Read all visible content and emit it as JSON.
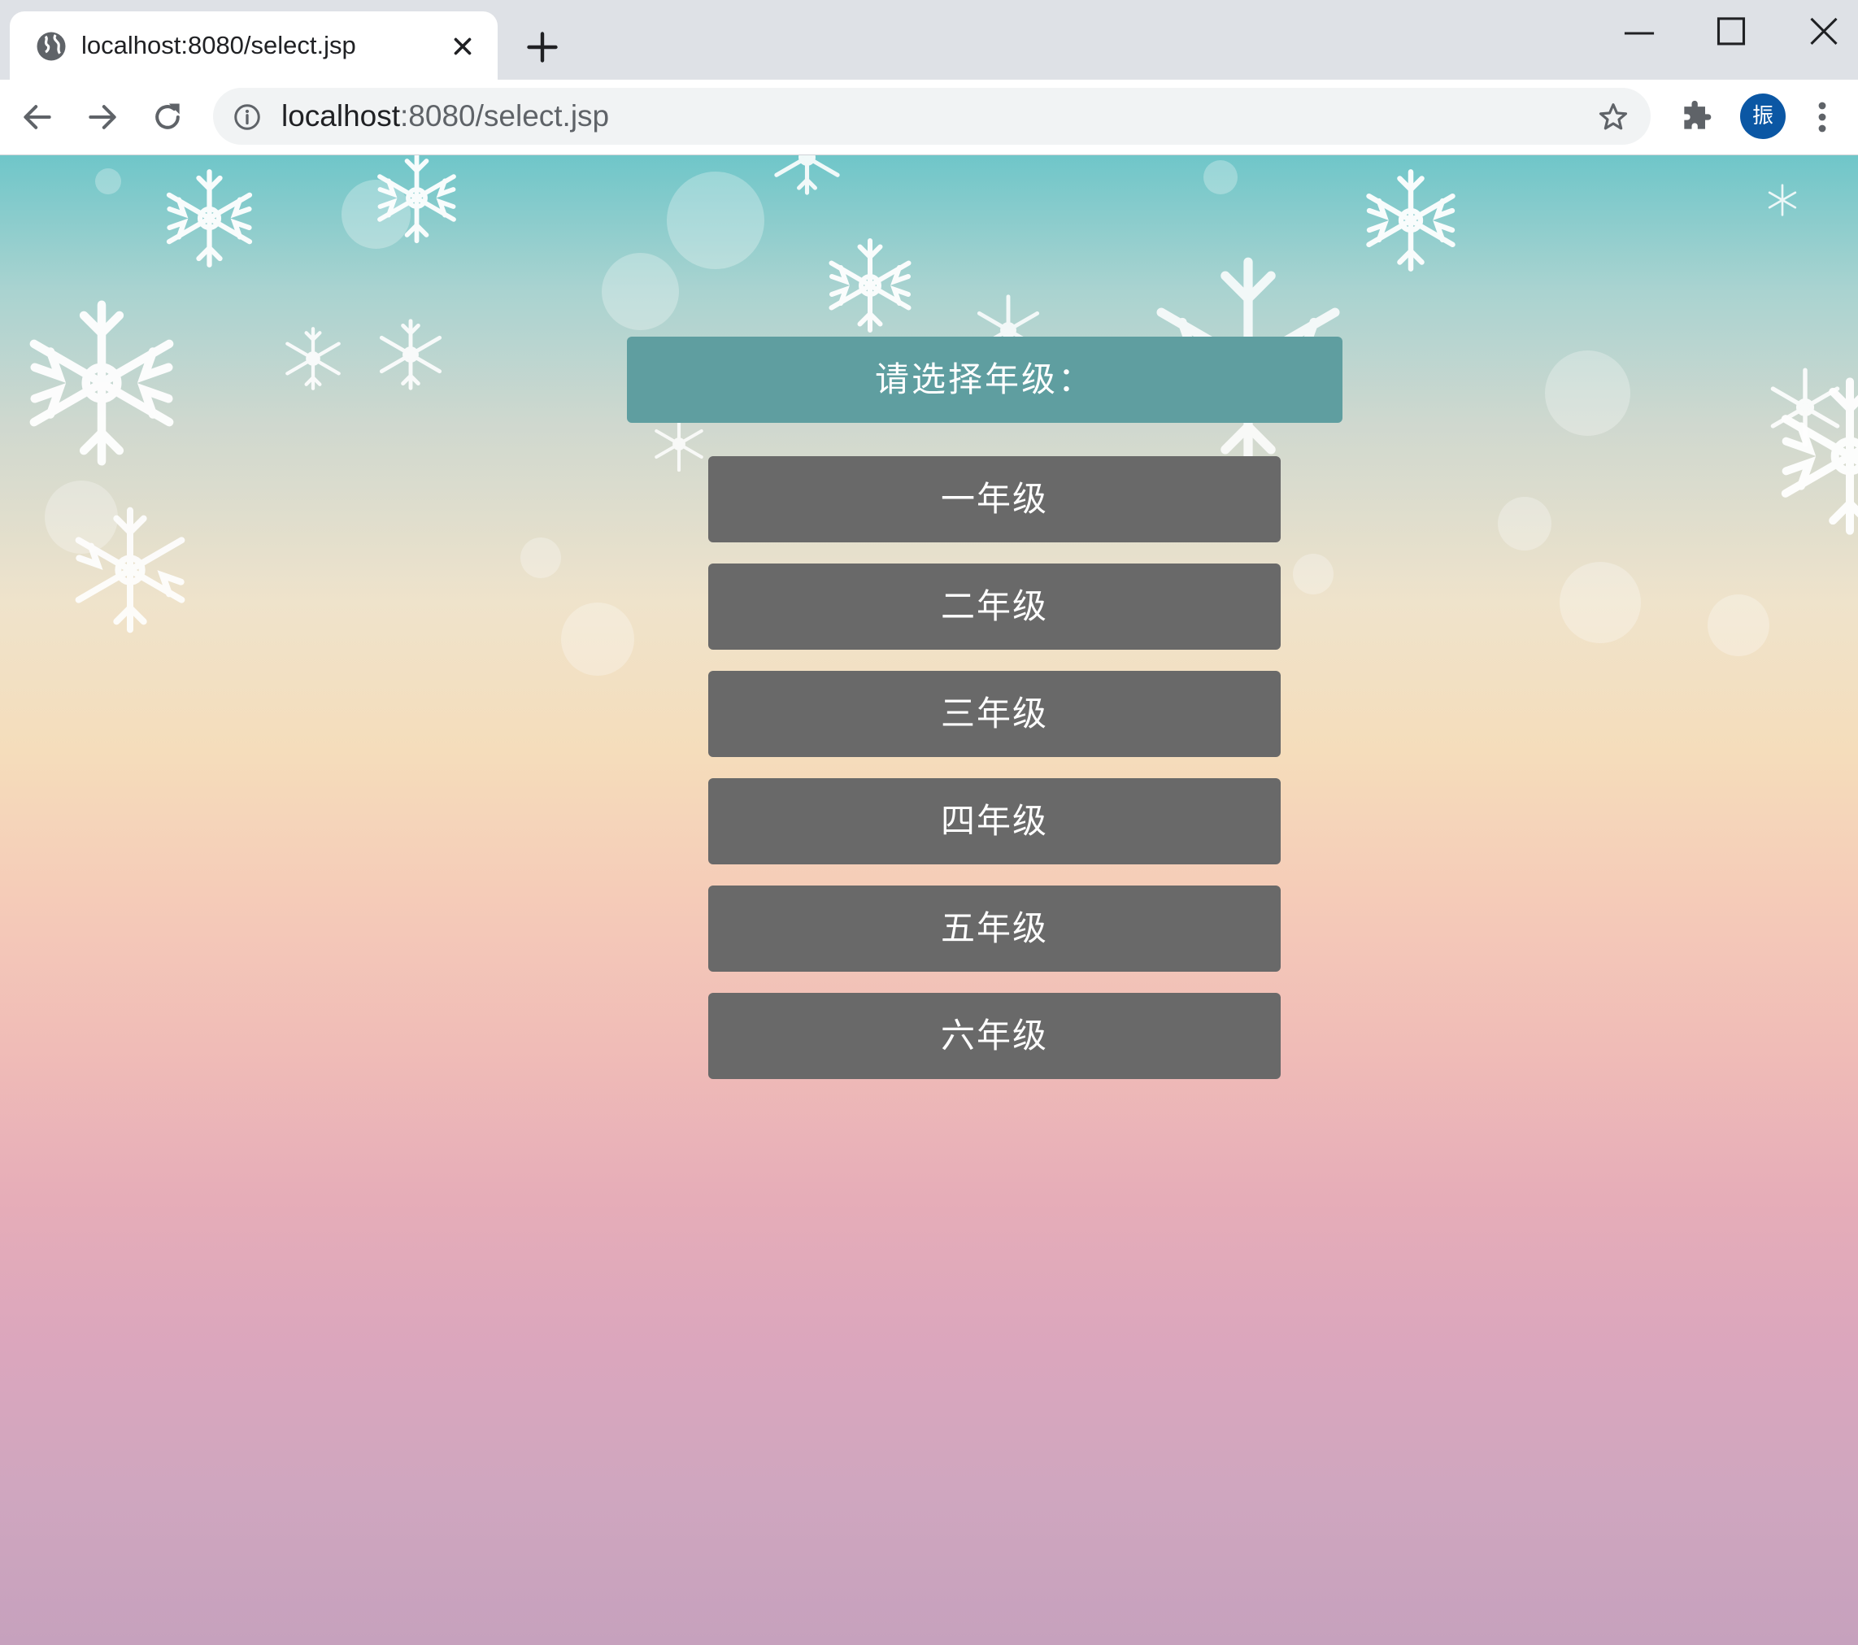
{
  "browser": {
    "tab_title": "localhost:8080/select.jsp",
    "url_host": "localhost",
    "url_rest": ":8080/select.jsp",
    "avatar_initial": "振"
  },
  "page": {
    "heading": "请选择年级：",
    "grades": [
      "一年级",
      "二年级",
      "三年级",
      "四年级",
      "五年级",
      "六年级"
    ]
  }
}
